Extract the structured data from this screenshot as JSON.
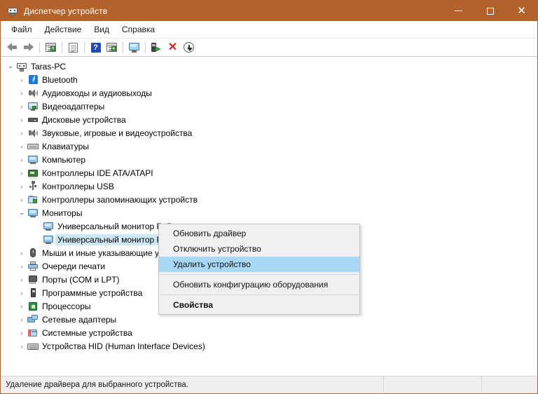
{
  "window": {
    "title": "Диспетчер устройств",
    "title_icon": "device-manager-icon",
    "accent_color": "#b4622c",
    "minimize_label": "—",
    "maximize_label": "□",
    "close_label": "✕"
  },
  "menubar": {
    "items": [
      {
        "label": "Файл"
      },
      {
        "label": "Действие"
      },
      {
        "label": "Вид"
      },
      {
        "label": "Справка"
      }
    ]
  },
  "toolbar": {
    "buttons": [
      {
        "name": "back-button",
        "icon": "back-arrow-icon"
      },
      {
        "name": "forward-button",
        "icon": "forward-arrow-icon"
      },
      {
        "name": "show-hide-console-tree-button",
        "icon": "console-tree-icon"
      },
      {
        "name": "properties-button",
        "icon": "properties-document-icon"
      },
      {
        "name": "help-button",
        "icon": "help-question-icon"
      },
      {
        "name": "show-hide-action-pane-button",
        "icon": "action-pane-icon"
      },
      {
        "name": "update-driver-button",
        "icon": "monitor-update-icon"
      },
      {
        "name": "scan-hardware-changes-button",
        "icon": "driver-arrow-icon"
      },
      {
        "name": "uninstall-device-button",
        "icon": "red-x-icon"
      },
      {
        "name": "download-button",
        "icon": "download-circle-icon"
      }
    ]
  },
  "tree": {
    "root": {
      "label": "Taras-PC",
      "icon": "computer-icon",
      "expanded": true
    },
    "items": [
      {
        "label": "Bluetooth",
        "icon": "bluetooth-icon",
        "expanded": false,
        "level": 1
      },
      {
        "label": "Аудиовходы и аудиовыходы",
        "icon": "speaker-icon",
        "expanded": false,
        "level": 1
      },
      {
        "label": "Видеоадаптеры",
        "icon": "video-adapter-icon",
        "expanded": false,
        "level": 1
      },
      {
        "label": "Дисковые устройства",
        "icon": "disk-drive-icon",
        "expanded": false,
        "level": 1
      },
      {
        "label": "Звуковые, игровые и видеоустройства",
        "icon": "speaker-icon",
        "expanded": false,
        "level": 1
      },
      {
        "label": "Клавиатуры",
        "icon": "keyboard-icon",
        "expanded": false,
        "level": 1
      },
      {
        "label": "Компьютер",
        "icon": "monitor-icon",
        "expanded": false,
        "level": 1
      },
      {
        "label": "Контроллеры IDE ATA/ATAPI",
        "icon": "ide-controller-icon",
        "expanded": false,
        "level": 1
      },
      {
        "label": "Контроллеры USB",
        "icon": "usb-icon",
        "expanded": false,
        "level": 1
      },
      {
        "label": "Контроллеры запоминающих устройств",
        "icon": "storage-controller-icon",
        "expanded": false,
        "level": 1
      },
      {
        "label": "Мониторы",
        "icon": "monitor-icon",
        "expanded": true,
        "level": 1
      },
      {
        "label": "Универсальный монитор PnP",
        "icon": "monitor-icon",
        "leaf": true,
        "level": 2
      },
      {
        "label": "Универсальный монитор PnP",
        "icon": "monitor-icon",
        "leaf": true,
        "level": 2,
        "selected": true
      },
      {
        "label": "Мыши и иные указывающие устройства",
        "icon": "mouse-icon",
        "expanded": false,
        "level": 1
      },
      {
        "label": "Очереди печати",
        "icon": "printer-icon",
        "expanded": false,
        "level": 1
      },
      {
        "label": "Порты (COM и LPT)",
        "icon": "port-icon",
        "expanded": false,
        "level": 1
      },
      {
        "label": "Программные устройства",
        "icon": "software-device-icon",
        "expanded": false,
        "level": 1
      },
      {
        "label": "Процессоры",
        "icon": "cpu-icon",
        "expanded": false,
        "level": 1
      },
      {
        "label": "Сетевые адаптеры",
        "icon": "network-adapter-icon",
        "expanded": false,
        "level": 1
      },
      {
        "label": "Системные устройства",
        "icon": "system-device-icon",
        "expanded": false,
        "level": 1
      },
      {
        "label": "Устройства HID (Human Interface Devices)",
        "icon": "hid-device-icon",
        "expanded": false,
        "level": 1
      }
    ],
    "collapsed_chevron": "›",
    "expanded_chevron": "⌄"
  },
  "context_menu": {
    "highlight_color": "#a8d8f5",
    "items": [
      {
        "label": "Обновить драйвер",
        "highlighted": false,
        "bold": false
      },
      {
        "label": "Отключить устройство",
        "highlighted": false,
        "bold": false
      },
      {
        "label": "Удалить устройство",
        "highlighted": true,
        "bold": false
      },
      {
        "separator": true
      },
      {
        "label": "Обновить конфигурацию оборудования",
        "highlighted": false,
        "bold": false
      },
      {
        "separator": true
      },
      {
        "label": "Свойства",
        "highlighted": false,
        "bold": true
      }
    ]
  },
  "statusbar": {
    "message": "Удаление драйвера для выбранного устройства.",
    "panel_mid": "",
    "panel_end": ""
  }
}
